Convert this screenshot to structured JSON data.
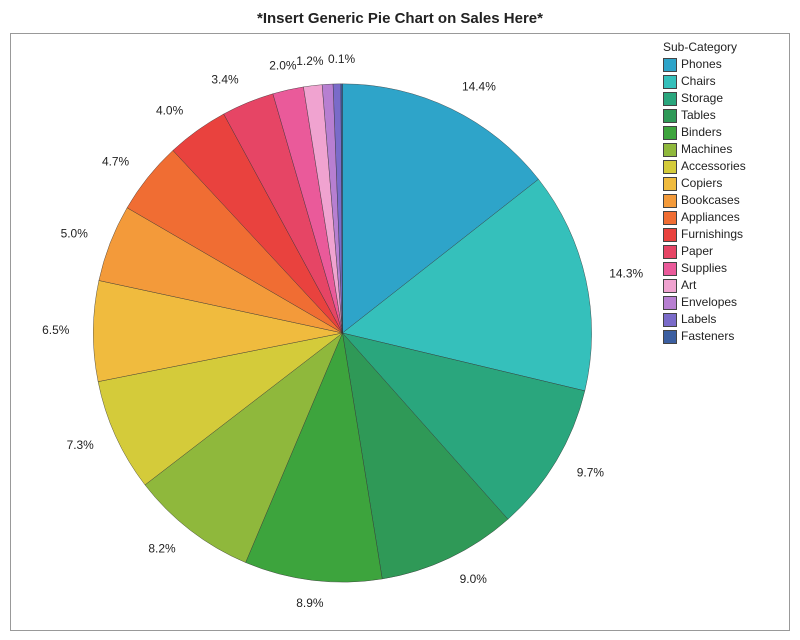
{
  "title": "*Insert Generic Pie Chart on Sales Here*",
  "legend_title": "Sub-Category",
  "chart_data": {
    "type": "pie",
    "title": "*Insert Generic Pie Chart on Sales Here*",
    "legend_position": "right",
    "series": [
      {
        "name": "Phones",
        "value": 14.4,
        "label": "14.4%",
        "color": "#2ea4c9"
      },
      {
        "name": "Chairs",
        "value": 14.3,
        "label": "14.3%",
        "color": "#35c0bb"
      },
      {
        "name": "Storage",
        "value": 9.7,
        "label": "9.7%",
        "color": "#2aa67d"
      },
      {
        "name": "Tables",
        "value": 9.0,
        "label": "9.0%",
        "color": "#2f9957"
      },
      {
        "name": "Binders",
        "value": 8.9,
        "label": "8.9%",
        "color": "#3da43d"
      },
      {
        "name": "Machines",
        "value": 8.2,
        "label": "8.2%",
        "color": "#8fb83c"
      },
      {
        "name": "Accessories",
        "value": 7.3,
        "label": "7.3%",
        "color": "#d4cb3a"
      },
      {
        "name": "Copiers",
        "value": 6.5,
        "label": "6.5%",
        "color": "#f0bb3e"
      },
      {
        "name": "Bookcases",
        "value": 5.0,
        "label": "5.0%",
        "color": "#f39a3a"
      },
      {
        "name": "Appliances",
        "value": 4.7,
        "label": "4.7%",
        "color": "#f06d33"
      },
      {
        "name": "Furnishings",
        "value": 4.0,
        "label": "4.0%",
        "color": "#e9423e"
      },
      {
        "name": "Paper",
        "value": 3.4,
        "label": "3.4%",
        "color": "#e64565"
      },
      {
        "name": "Supplies",
        "value": 2.0,
        "label": "2.0%",
        "color": "#ea5a9a"
      },
      {
        "name": "Art",
        "value": 1.2,
        "label": "1.2%",
        "color": "#f0a3d0"
      },
      {
        "name": "Envelopes",
        "value": 0.7,
        "label": "",
        "color": "#b77fd1"
      },
      {
        "name": "Labels",
        "value": 0.5,
        "label": "",
        "color": "#7a6bc9"
      },
      {
        "name": "Fasteners",
        "value": 0.1,
        "label": "0.1%",
        "color": "#3b5ea0"
      }
    ]
  }
}
